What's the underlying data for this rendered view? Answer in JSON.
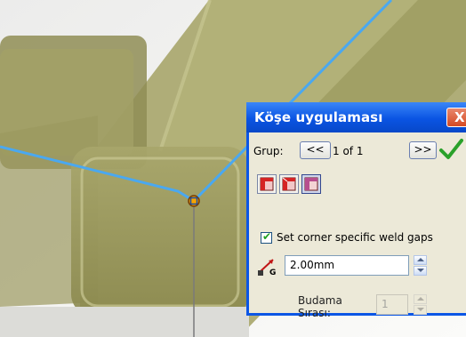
{
  "dialog": {
    "title": "Köşe uygulaması",
    "close_symbol": "X",
    "group_label": "Grup:",
    "prev_label": "<<",
    "page_info": "1 of 1",
    "next_label": ">>",
    "ok_icon": "check-icon",
    "checkbox_label": "Set corner specific weld gaps",
    "checkbox_checked": true,
    "weld_gap_value": "2.00mm",
    "weld_gap_icon_letter": "G",
    "trim_order_label_line1": "Budama",
    "trim_order_label_line2": "Sırası:",
    "trim_order_value": "1",
    "corner_type_icons": [
      "corner-type-1-icon",
      "corner-type-2-icon",
      "corner-type-3-icon"
    ],
    "selected_corner_type": 3
  },
  "colors": {
    "tube_fill": "#9c9a5d",
    "sketch_line": "#4aa8f0",
    "dialog_titlebar": "#0a54e3",
    "dialog_body": "#ece9d8",
    "close_button": "#d44a24",
    "ok_check": "#2aa12a"
  }
}
